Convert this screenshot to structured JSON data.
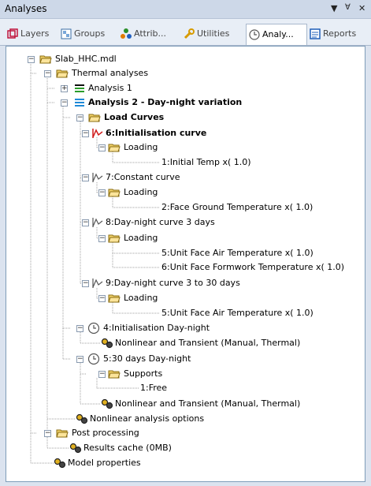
{
  "window": {
    "title": "Analyses",
    "pin_icon": "pin-icon",
    "close_icon": "close-icon",
    "dropdown_icon": "dropdown-icon"
  },
  "tabs": [
    {
      "label": "Layers",
      "icon": "layers-icon"
    },
    {
      "label": "Groups",
      "icon": "groups-icon"
    },
    {
      "label": "Attrib...",
      "icon": "attributes-icon"
    },
    {
      "label": "Utilities",
      "icon": "utilities-icon"
    },
    {
      "label": "Analy...",
      "icon": "analyses-icon",
      "active": true
    },
    {
      "label": "Reports",
      "icon": "reports-icon"
    }
  ],
  "tree": {
    "root": "Slab_HHC.mdl",
    "thermal_analyses": "Thermal analyses",
    "analysis1": "Analysis 1",
    "analysis2": "Analysis 2 - Day-night variation",
    "load_curves": "Load Curves",
    "curve6": "6:Initialisation curve",
    "loading_a": "Loading",
    "initial_temp": "1:Initial Temp x( 1.0)",
    "curve7": "7:Constant curve",
    "loading_b": "Loading",
    "face_ground": "2:Face Ground Temperature x( 1.0)",
    "curve8": "8:Day-night curve 3 days",
    "loading_c": "Loading",
    "face_air_1": "5:Unit Face Air Temperature x( 1.0)",
    "formwork": "6:Unit Face Formwork Temperature x( 1.0)",
    "curve9": "9:Day-night curve 3 to 30 days",
    "loading_d": "Loading",
    "face_air_2": "5:Unit Face Air Temperature x( 1.0)",
    "stage4": "4:Initialisation Day-night",
    "nonlinear_1": "Nonlinear and Transient (Manual, Thermal)",
    "stage5": "5:30 days Day-night",
    "supports": "Supports",
    "free": "1:Free",
    "nonlinear_2": "Nonlinear and Transient (Manual, Thermal)",
    "nonlinear_options": "Nonlinear analysis options",
    "post_processing": "Post processing",
    "results_cache": "Results cache (0MB)",
    "model_properties": "Model properties"
  }
}
